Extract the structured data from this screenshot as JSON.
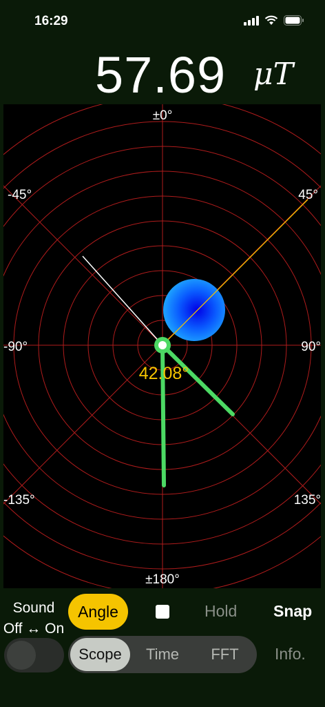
{
  "status_bar": {
    "time": "16:29"
  },
  "reading": {
    "value": "57.69",
    "unit": "μT"
  },
  "scope": {
    "angle_labels": {
      "top": "±0°",
      "upper_left": "-45°",
      "upper_right": "45°",
      "left": "-90°",
      "right": "90°",
      "lower_left": "-135°",
      "lower_right": "135°",
      "bottom": "±180°"
    },
    "angle_readout": "42.08°",
    "colors": {
      "grid": "#b01c1c",
      "readout": "#f5c400",
      "needle": "#4cd964",
      "blob_center": "#0000ff",
      "blob_edge": "#1e90ff"
    }
  },
  "controls": {
    "sound_line1": "Sound",
    "sound_line2": "Off ↔ On",
    "angle": "Angle",
    "hold": "Hold",
    "snap": "Snap",
    "tabs": [
      "Scope",
      "Time",
      "FFT"
    ],
    "selected_tab": "Scope",
    "info": "Info."
  }
}
